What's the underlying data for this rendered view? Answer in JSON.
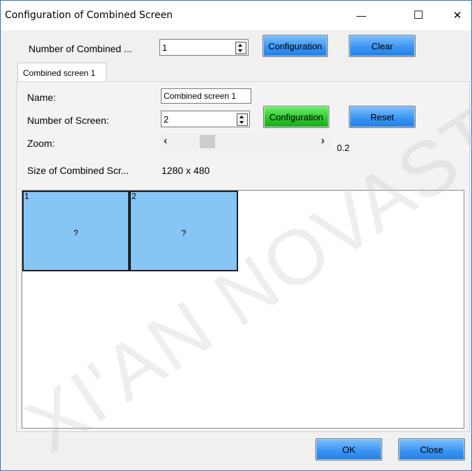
{
  "window": {
    "title": "Configuration of Combined Screen",
    "controls": {
      "minimize": "—",
      "maximize": "☐",
      "close": "✕"
    }
  },
  "top": {
    "number_label": "Number of Combined ...",
    "number_value": "1",
    "configuration_label": "Configuration",
    "clear_label": "Clear"
  },
  "tab": {
    "label": "Combined screen 1"
  },
  "form": {
    "name_label": "Name:",
    "name_value": "Combined screen 1",
    "screens_label": "Number of Screen:",
    "screens_value": "2",
    "configuration_label": "Configuration",
    "reset_label": "Reset",
    "zoom_label": "Zoom:",
    "zoom_left": "‹",
    "zoom_right": "›",
    "zoom_value": "0.2",
    "zoom_level": 0.2,
    "size_label": "Size of Combined Scr...",
    "size_value": "1280 x 480"
  },
  "screens": [
    {
      "number": "1",
      "content": "?"
    },
    {
      "number": "2",
      "content": "?"
    }
  ],
  "footer": {
    "ok_label": "OK",
    "close_label": "Close"
  },
  "watermark": "XI'AN NOVASTAR",
  "colors": {
    "accent_blue": "#3d95f2",
    "accent_green": "#2ec92e",
    "screen_fill": "#86c5f4",
    "window_border": "#2b78c8"
  }
}
